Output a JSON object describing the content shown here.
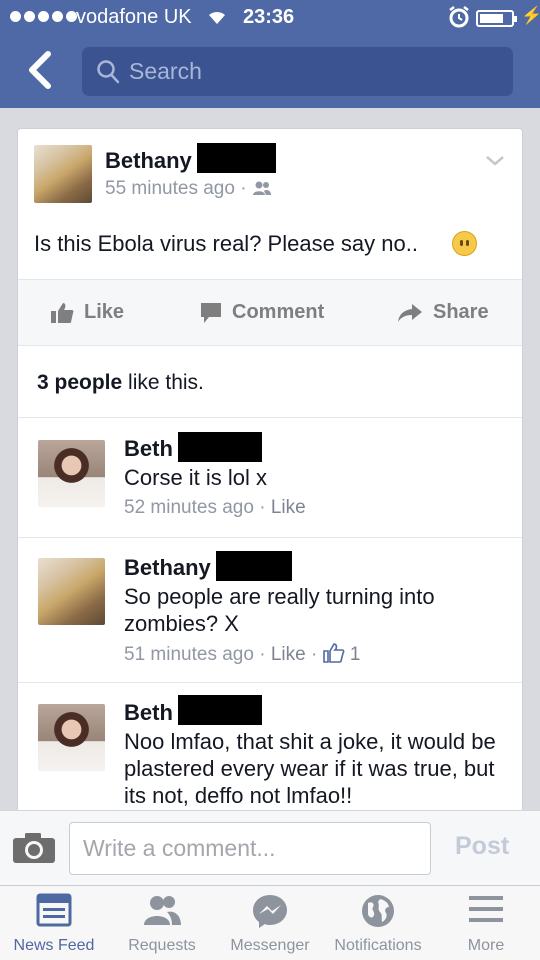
{
  "status_bar": {
    "carrier": "vodafone UK",
    "time": "23:36",
    "battery_level": 0.75
  },
  "header": {
    "search_placeholder": "Search",
    "back_icon": "chevron-left-icon",
    "search_icon": "search-icon"
  },
  "post": {
    "author": "Bethany",
    "time": "55 minutes ago",
    "meta_sep": "·",
    "audience_icon": "friends-icon",
    "text": "Is this Ebola virus real? Please say no..",
    "emoji": "confused-face-icon",
    "actions": {
      "like": "Like",
      "comment": "Comment",
      "share": "Share"
    },
    "likes_count": "3 people",
    "likes_suffix": " like this."
  },
  "comments": [
    {
      "author": "Beth",
      "text": "Corse it is lol x",
      "time": "52 minutes ago",
      "sep": "·",
      "like": "Like"
    },
    {
      "author": "Bethany",
      "text": "So people are really turning into zombies? X",
      "time": "51 minutes ago",
      "sep": "·",
      "like": "Like",
      "sep2": "·",
      "like_count": "1"
    },
    {
      "author": "Beth",
      "text": "Noo lmfao, that shit a joke, it would be plastered every wear if it was true, but its not, deffo not lmfao!!"
    }
  ],
  "comment_bar": {
    "placeholder": "Write a comment...",
    "post_label": "Post"
  },
  "tabs": [
    {
      "label": "News Feed",
      "icon": "news-feed-icon",
      "active": true
    },
    {
      "label": "Requests",
      "icon": "friend-requests-icon"
    },
    {
      "label": "Messenger",
      "icon": "messenger-icon"
    },
    {
      "label": "Notifications",
      "icon": "globe-icon"
    },
    {
      "label": "More",
      "icon": "menu-icon"
    }
  ],
  "colors": {
    "header_blue": "#4f69a6",
    "search_bg": "#3b5390",
    "active_tab": "#4e69a2",
    "inactive_tab": "#8d949e"
  }
}
